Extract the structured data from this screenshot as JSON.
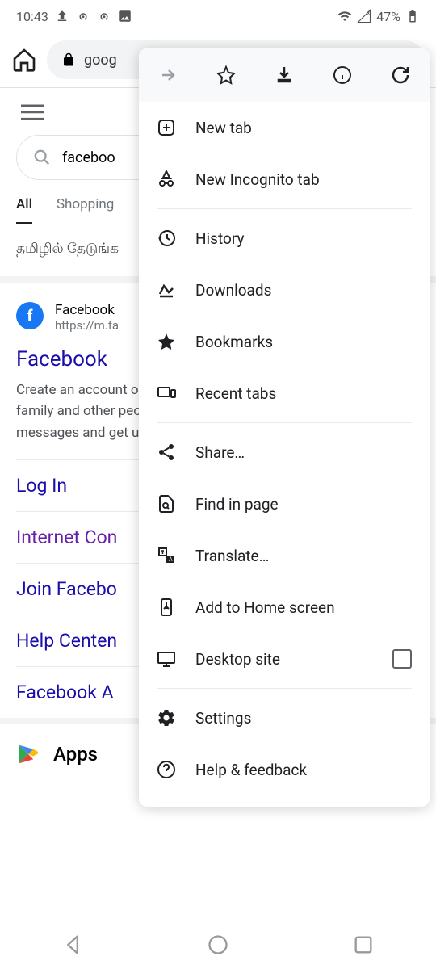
{
  "status_bar": {
    "time": "10:43",
    "battery": "47%"
  },
  "address_bar": {
    "url_text": "goog"
  },
  "search": {
    "query": "faceboo"
  },
  "tabs": {
    "all": "All",
    "shopping": "Shopping"
  },
  "suggestion": "தமிழில் தேடுங்க",
  "result": {
    "site": "Facebook",
    "url": "https://m.fa",
    "title": "Facebook",
    "desc": "Create an account or log into Facebook. Connect with friends, family and other people you know. Share photos and videos, send messages and get updates.",
    "sublinks": {
      "login": "Log In",
      "internet": "Internet Con",
      "join": "Join Facebo",
      "help": "Help Centen",
      "apps_link": "Facebook A"
    }
  },
  "apps_section": {
    "title": "Apps"
  },
  "menu": {
    "new_tab": "New tab",
    "incognito": "New Incognito tab",
    "history": "History",
    "downloads": "Downloads",
    "bookmarks": "Bookmarks",
    "recent_tabs": "Recent tabs",
    "share": "Share…",
    "find": "Find in page",
    "translate": "Translate…",
    "add_home": "Add to Home screen",
    "desktop": "Desktop site",
    "settings": "Settings",
    "help": "Help & feedback"
  }
}
